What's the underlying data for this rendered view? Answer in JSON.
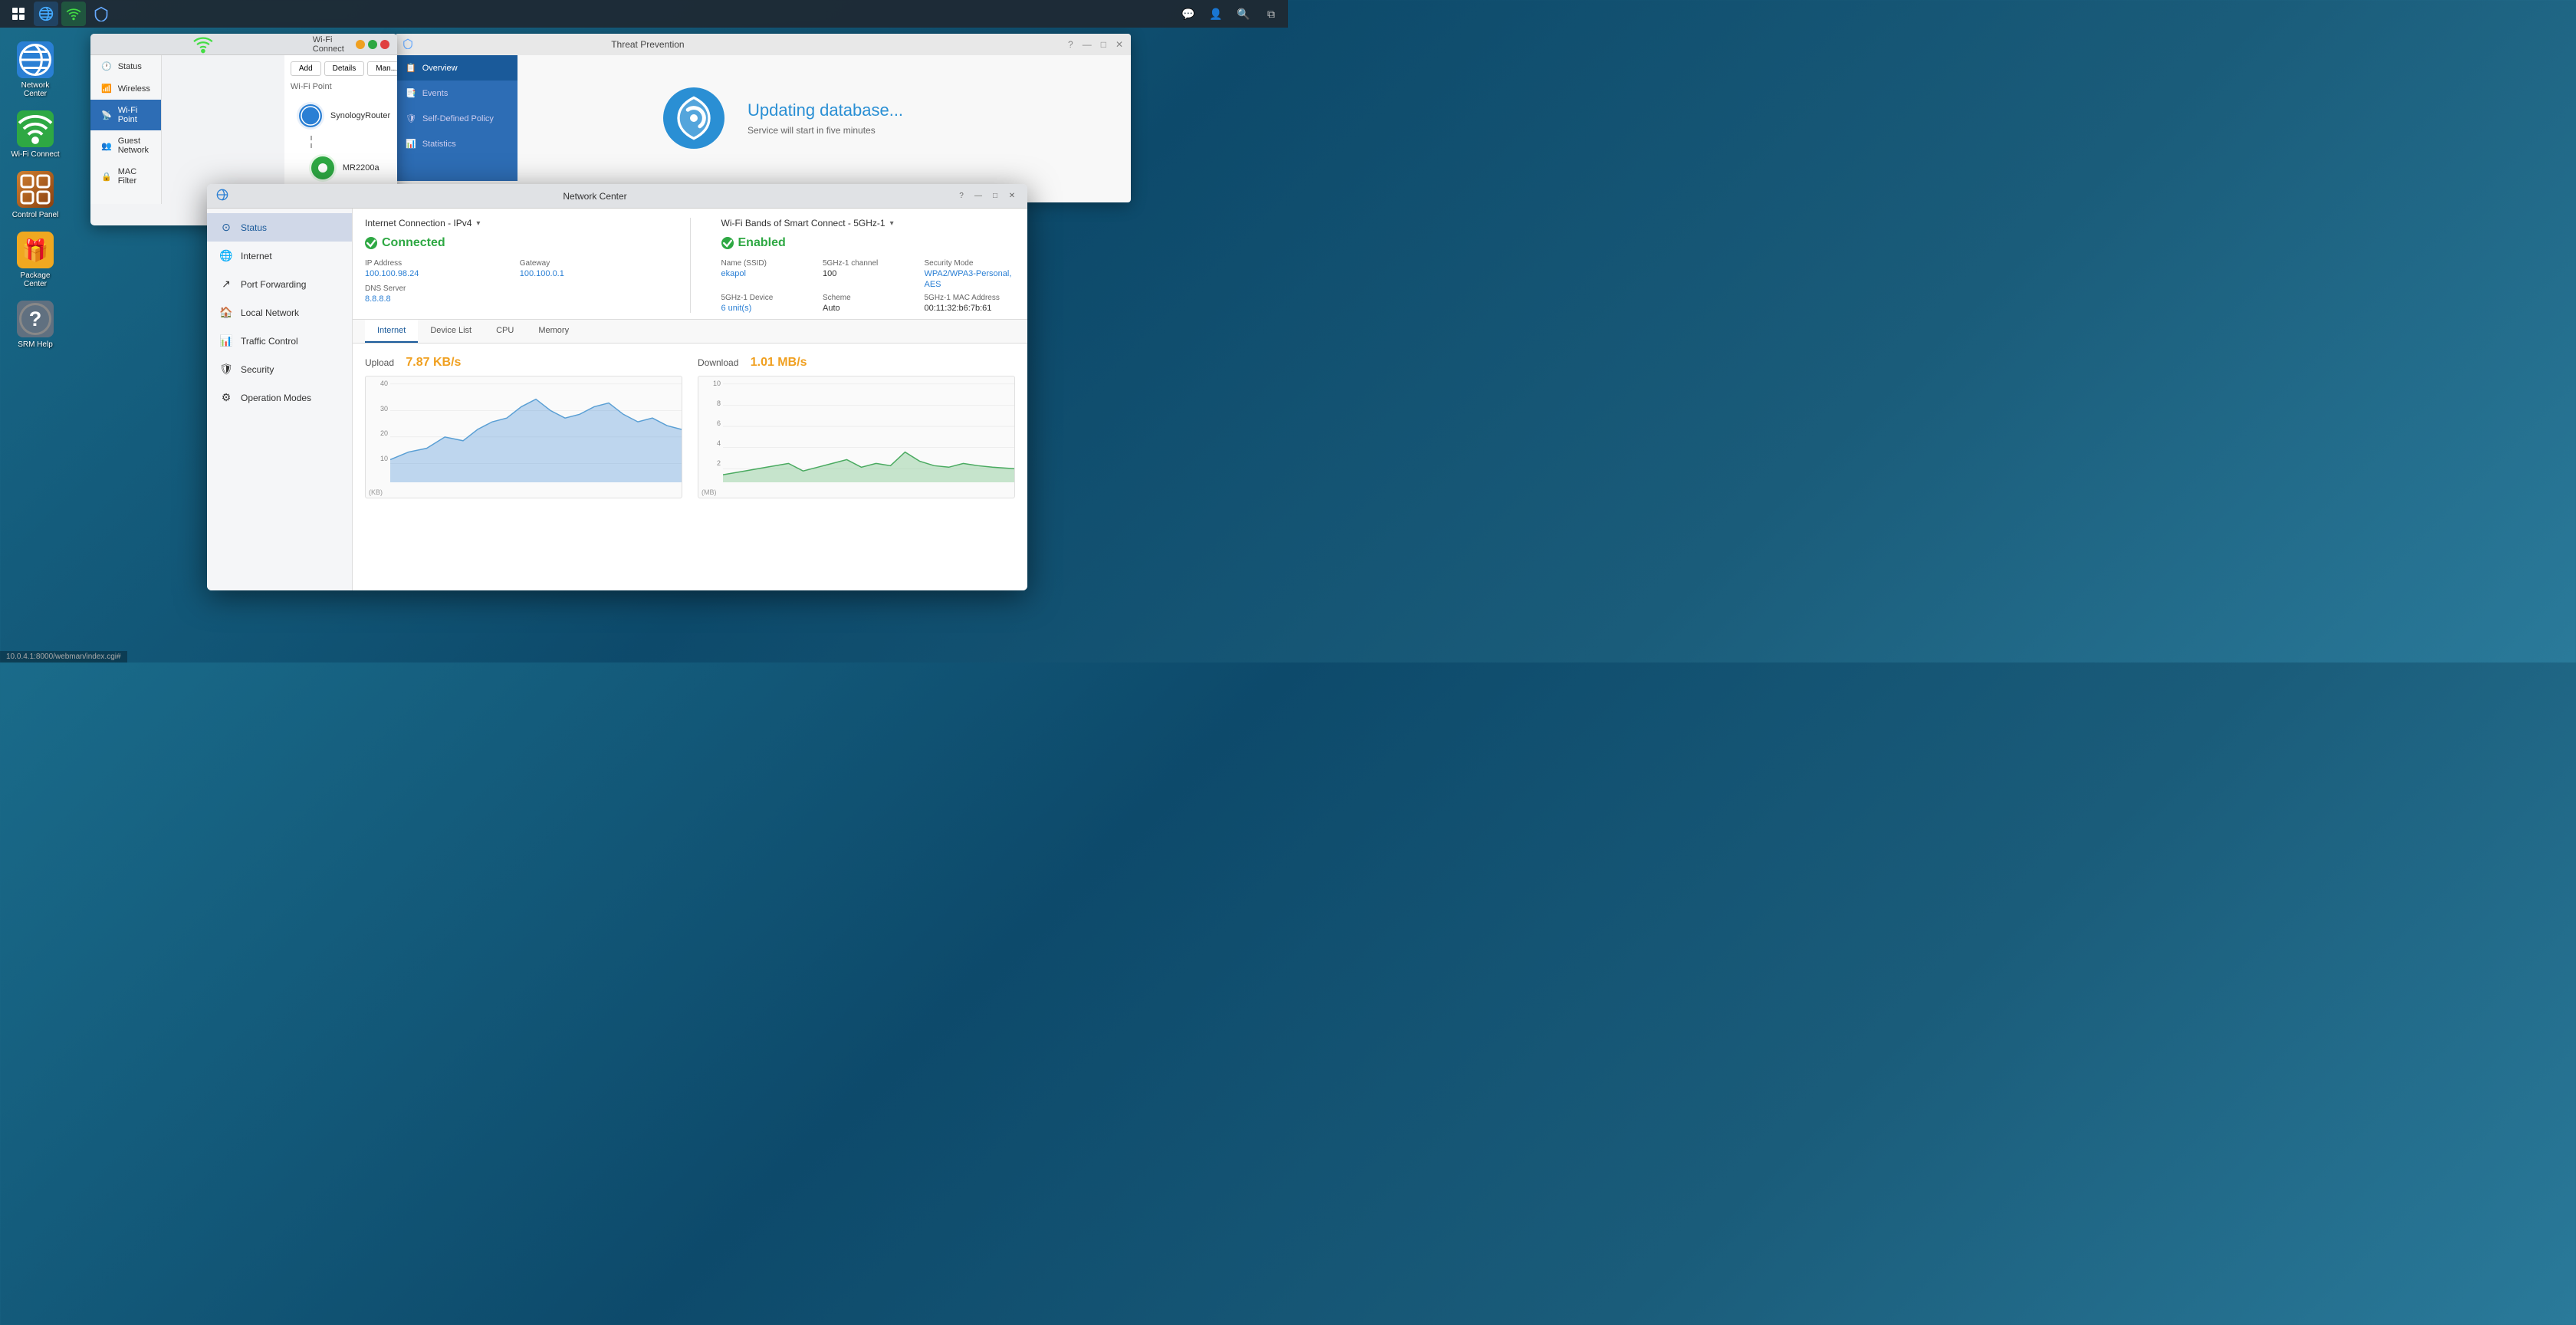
{
  "taskbar": {
    "apps": [
      {
        "name": "grid-icon",
        "label": "App Grid",
        "symbol": "⊞"
      },
      {
        "name": "network-center-icon",
        "label": "Network Center",
        "symbol": "🌐"
      },
      {
        "name": "wifi-connect-icon",
        "label": "Wi-Fi Connect",
        "symbol": "📶"
      },
      {
        "name": "threat-icon",
        "label": "Threat Prevention",
        "symbol": "🛡"
      }
    ],
    "right": [
      {
        "name": "chat-icon",
        "symbol": "💬"
      },
      {
        "name": "user-icon",
        "symbol": "👤"
      },
      {
        "name": "search-icon",
        "symbol": "🔍"
      },
      {
        "name": "windows-icon",
        "symbol": "⧉"
      }
    ]
  },
  "desktop_icons": [
    {
      "id": "network-center",
      "label": "Network Center",
      "bg": "#2a7fd4",
      "symbol": "🌐"
    },
    {
      "id": "wifi-connect",
      "label": "Wi-Fi Connect",
      "bg": "#2ea843",
      "symbol": "📶"
    },
    {
      "id": "control-panel",
      "label": "Control Panel",
      "bg": "#8a6020",
      "symbol": "⚙"
    },
    {
      "id": "package-center",
      "label": "Package Center",
      "bg": "#f0a820",
      "symbol": "🎁"
    },
    {
      "id": "srm-help",
      "label": "SRM Help",
      "bg": "#888",
      "symbol": "?"
    }
  ],
  "url_bar": {
    "url": "10.0.4.1:8000/webman/index.cgi#"
  },
  "wificonn_panel": {
    "title": "",
    "sidebar_items": [
      {
        "id": "status",
        "label": "Status",
        "icon": "🕐"
      },
      {
        "id": "wireless",
        "label": "Wireless",
        "icon": "📶"
      },
      {
        "id": "wi-fi-point",
        "label": "Wi-Fi Point",
        "icon": "📡",
        "active": true
      },
      {
        "id": "guest-network",
        "label": "Guest Network",
        "icon": "👥"
      },
      {
        "id": "mac-filter",
        "label": "MAC Filter",
        "icon": "🔒"
      }
    ],
    "toolbar": {
      "add": "Add",
      "details": "Details",
      "manage": "Man..."
    },
    "breadcrumb": "Wi-Fi Point",
    "routers": [
      {
        "name": "SynologyRouter",
        "icon": "🔵"
      },
      {
        "name": "MR2200a",
        "icon": "🔵"
      }
    ]
  },
  "threat_panel": {
    "title": "Threat Prevention",
    "sidebar_items": [
      {
        "id": "overview",
        "label": "Overview",
        "icon": "📋",
        "active": true
      },
      {
        "id": "events",
        "label": "Events",
        "icon": "📑"
      },
      {
        "id": "self-defined",
        "label": "Self-Defined Policy",
        "icon": "🛡"
      },
      {
        "id": "statistics",
        "label": "Statistics",
        "icon": "📊"
      }
    ],
    "status": {
      "title": "Updating database...",
      "subtitle": "Service will start in five minutes"
    }
  },
  "network_center": {
    "title": "Network Center",
    "sidebar_items": [
      {
        "id": "status",
        "label": "Status",
        "icon": "⊙",
        "active": true
      },
      {
        "id": "internet",
        "label": "Internet",
        "icon": "🌐"
      },
      {
        "id": "port-forwarding",
        "label": "Port Forwarding",
        "icon": "↗"
      },
      {
        "id": "local-network",
        "label": "Local Network",
        "icon": "🏠"
      },
      {
        "id": "traffic-control",
        "label": "Traffic Control",
        "icon": "📊"
      },
      {
        "id": "security",
        "label": "Security",
        "icon": "🛡"
      },
      {
        "id": "operation-modes",
        "label": "Operation Modes",
        "icon": "⚙"
      }
    ],
    "internet_connection": {
      "label": "Internet Connection - IPv4",
      "status": "Connected",
      "ip_address_label": "IP Address",
      "ip_address": "100.100.98.24",
      "gateway_label": "Gateway",
      "gateway": "100.100.0.1",
      "dns_label": "DNS Server",
      "dns": "8.8.8.8"
    },
    "wifi_bands": {
      "label": "Wi-Fi Bands of Smart Connect - 5GHz-1",
      "status": "Enabled",
      "ssid_label": "Name (SSID)",
      "ssid": "ekapol",
      "security_label": "Security Mode",
      "security": "WPA2/WPA3-Personal, AES",
      "scheme_label": "Scheme",
      "scheme": "Auto",
      "channel_label": "5GHz-1 channel",
      "channel": "100",
      "device_label": "5GHz-1 Device",
      "device": "6 unit(s)",
      "mac_label": "5GHz-1 MAC Address",
      "mac": "00:11:32:b6:7b:61"
    },
    "tabs": [
      {
        "id": "internet",
        "label": "Internet",
        "active": true
      },
      {
        "id": "device-list",
        "label": "Device List"
      },
      {
        "id": "cpu",
        "label": "CPU"
      },
      {
        "id": "memory",
        "label": "Memory"
      }
    ],
    "upload": {
      "label": "Upload",
      "value": "7.87 KB/s",
      "y_labels": [
        "40",
        "30",
        "20",
        "10",
        ""
      ],
      "unit": "(KB)"
    },
    "download": {
      "label": "Download",
      "value": "1.01 MB/s",
      "y_labels": [
        "10",
        "8",
        "6",
        "4",
        "2",
        ""
      ],
      "unit": "(MB)"
    }
  }
}
